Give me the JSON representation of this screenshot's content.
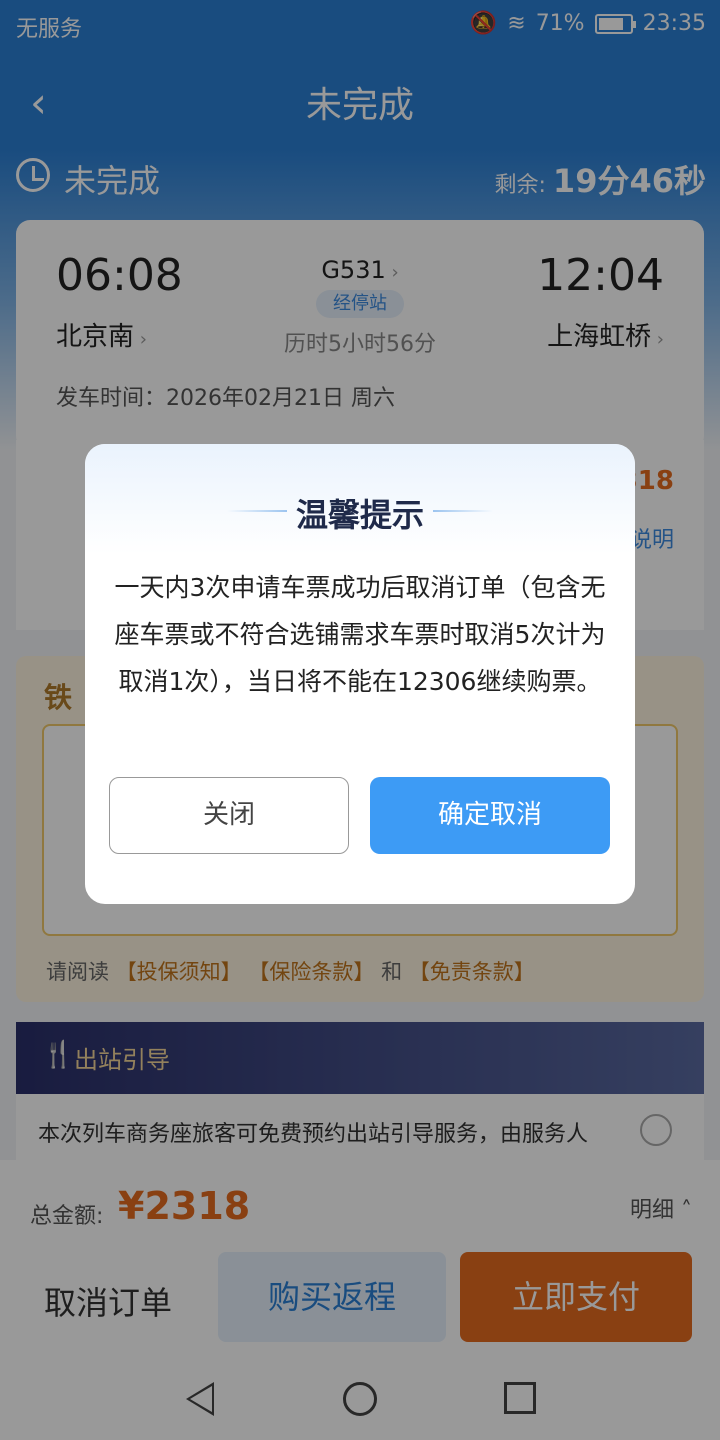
{
  "status_bar": {
    "carrier": "无服务",
    "battery_percent": "71%",
    "time": "23:35"
  },
  "header": {
    "title": "未完成"
  },
  "order_state": {
    "label": "未完成",
    "remaining_label": "剩余:",
    "remaining_time": "19分46秒"
  },
  "trip": {
    "depart_time": "06:08",
    "depart_station": "北京南",
    "train_number": "G531",
    "stops_label": "经停站",
    "duration": "历时5小时56分",
    "arrive_time": "12:04",
    "arrive_station": "上海虹桥",
    "date_line": "发车时间：2026年02月21日 周六"
  },
  "passenger": {
    "price_partial": "318",
    "link_partial": "说明"
  },
  "insurance": {
    "title_partial": "铁",
    "read_prefix": "请阅读",
    "notice": "【投保须知】",
    "terms": "【保险条款】",
    "and": "和",
    "disclaimer": "【免责条款】"
  },
  "guide": {
    "title": "出站引导",
    "icon": "fork-knife-icon",
    "text": "本次列车商务座旅客可免费预约出站引导服务，由服务人"
  },
  "bottom_bar": {
    "total_label": "总金额:",
    "total_amount": "¥2318",
    "detail_label": "明细",
    "cancel_order": "取消订单",
    "buy_return": "购买返程",
    "pay_now": "立即支付"
  },
  "dialog": {
    "title": "温馨提示",
    "message": "一天内3次申请车票成功后取消订单（包含无座车票或不符合选铺需求车票时取消5次计为取消1次），当日将不能在12306继续购票。",
    "close_label": "关闭",
    "confirm_label": "确定取消"
  },
  "colors": {
    "header_blue": "#2b7fd4",
    "accent_orange": "#e56b1f",
    "confirm_blue": "#3d9bf5"
  }
}
